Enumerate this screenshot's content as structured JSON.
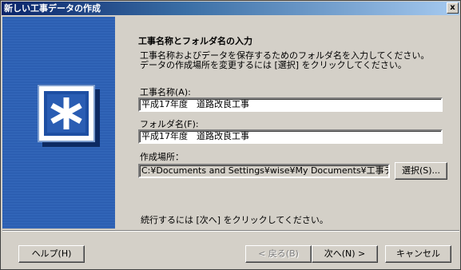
{
  "window": {
    "title": "新しい工事データの作成",
    "close_label": "x"
  },
  "main": {
    "heading": "工事名称とフォルダ名の入力",
    "description_line1": "工事名称およびデータを保存するためのフォルダ名を入力してください。",
    "description_line2": "データの作成場所を変更するには [選択] をクリックしてください。",
    "project_name": {
      "label": "工事名称(A):",
      "value": "平成17年度　道路改良工事"
    },
    "folder_name": {
      "label": "フォルダ名(F):",
      "value": "平成17年度　道路改良工事"
    },
    "location": {
      "label": "作成場所：",
      "value": "C:¥Documents and Settings¥wise¥My Documents¥工事データ¥",
      "select_label": "選択(S)..."
    },
    "footer_note": "続行するには [次へ] をクリックしてください。"
  },
  "buttons": {
    "help": "ヘルプ(H)",
    "back": "< 戻る(B)",
    "next": "次へ(N) >",
    "cancel": "キャンセル"
  },
  "colors": {
    "title_bar": "#0a246a",
    "banner": "#1e4fa3",
    "face": "#d4d0c8"
  }
}
